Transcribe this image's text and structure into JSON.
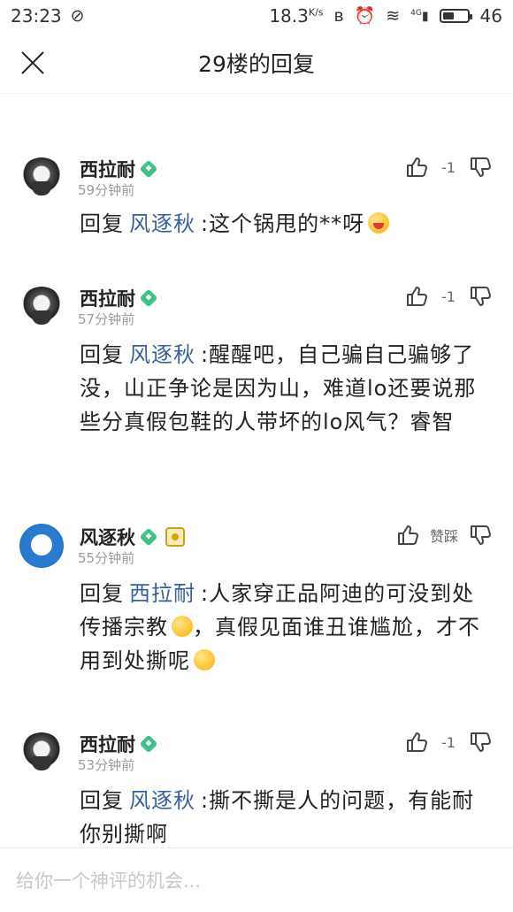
{
  "status_bar": {
    "time": "23:23",
    "speed": "18.3",
    "speed_unit": "K/s",
    "network": "4G",
    "battery": "46",
    "battery_fraction": 0.46
  },
  "header": {
    "title": "29楼的回复"
  },
  "comments": [
    {
      "username": "西拉耐",
      "time": "59分钟前",
      "count": "-1",
      "prefix": "回复",
      "mention": "风逐秋",
      "text": ":这个锅甩的**呀"
    },
    {
      "username": "西拉耐",
      "time": "57分钟前",
      "count": "-1",
      "prefix": "回复",
      "mention": "风逐秋",
      "text": ":醒醒吧，自己骗自己骗够了没，山正争论是因为山，难道lo还要说那些分真假包鞋的人带坏的lo风气？睿智"
    },
    {
      "username": "风逐秋",
      "time": "55分钟前",
      "action_label": "赞踩",
      "prefix": "回复",
      "mention": "西拉耐",
      "text_a": ":人家穿正品阿迪的可没到处传播宗教",
      "text_b": "，真假见面谁丑谁尴尬，才不用到处撕呢"
    },
    {
      "username": "西拉耐",
      "time": "53分钟前",
      "count": "-1",
      "prefix": "回复",
      "mention": "风逐秋",
      "text": ":撕不撕是人的问题，有能耐你别撕啊"
    }
  ],
  "composer": {
    "placeholder": "给你一个神评的机会..."
  },
  "colors": {
    "mention": "#3a5d9e",
    "verified_badge": "#3cc389",
    "muted_text": "#9a9a9a"
  }
}
